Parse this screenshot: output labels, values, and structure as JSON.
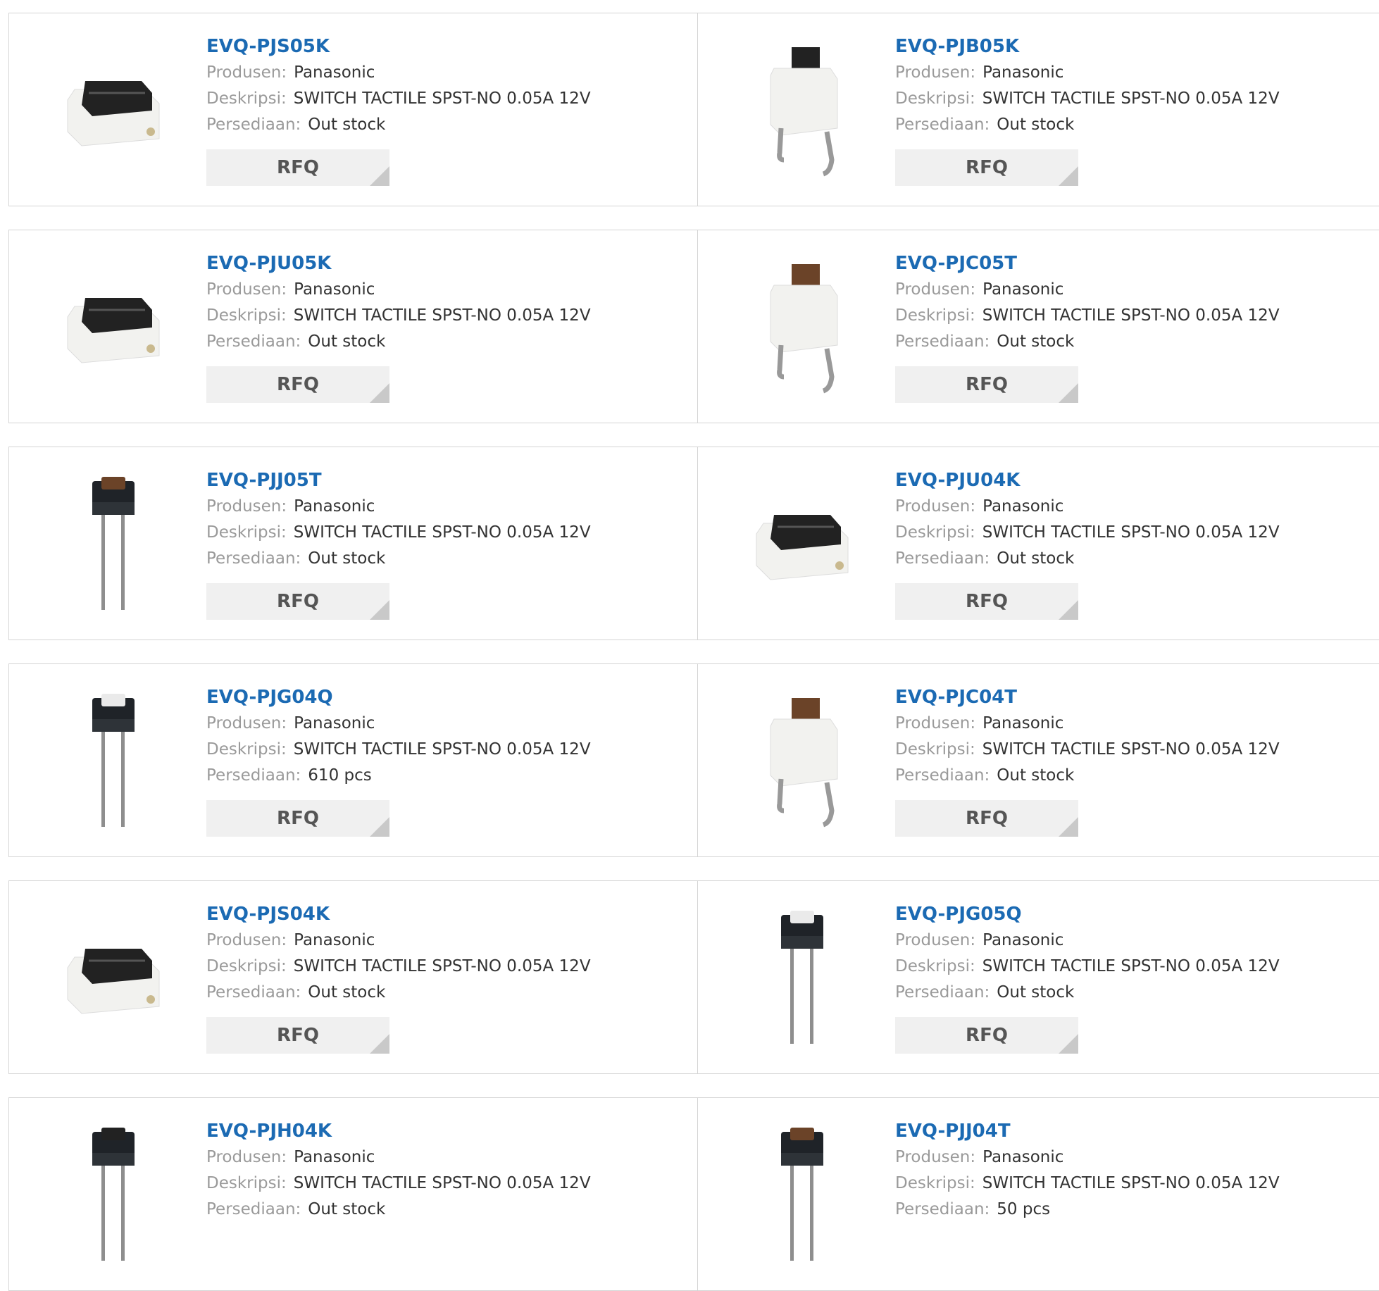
{
  "labels": {
    "manufacturer": "Produsen:",
    "description": "Deskripsi:",
    "stock": "Persediaan:",
    "rfq": "RFQ"
  },
  "colors": {
    "link": "#1b6ab3",
    "label": "#9a9a9a",
    "button_bg": "#f0f0f0"
  },
  "products": [
    {
      "pn": "EVQ-PJS05K",
      "manufacturer": "Panasonic",
      "description": "SWITCH TACTILE SPST-NO 0.05A 12V",
      "stock": "Out stock",
      "image": "switch-smd-black-icon",
      "show_rfq": true
    },
    {
      "pn": "EVQ-PJB05K",
      "manufacturer": "Panasonic",
      "description": "SWITCH TACTILE SPST-NO 0.05A 12V",
      "stock": "Out stock",
      "image": "switch-ra-black-icon",
      "show_rfq": true
    },
    {
      "pn": "EVQ-PJU05K",
      "manufacturer": "Panasonic",
      "description": "SWITCH TACTILE SPST-NO 0.05A 12V",
      "stock": "Out stock",
      "image": "switch-smd-black-icon",
      "show_rfq": true
    },
    {
      "pn": "EVQ-PJC05T",
      "manufacturer": "Panasonic",
      "description": "SWITCH TACTILE SPST-NO 0.05A 12V",
      "stock": "Out stock",
      "image": "switch-ra-brown-icon",
      "show_rfq": true
    },
    {
      "pn": "EVQ-PJJ05T",
      "manufacturer": "Panasonic",
      "description": "SWITCH TACTILE SPST-NO 0.05A 12V",
      "stock": "Out stock",
      "image": "switch-th-brown-icon",
      "show_rfq": true
    },
    {
      "pn": "EVQ-PJU04K",
      "manufacturer": "Panasonic",
      "description": "SWITCH TACTILE SPST-NO 0.05A 12V",
      "stock": "Out stock",
      "image": "switch-smd-black-icon",
      "show_rfq": true
    },
    {
      "pn": "EVQ-PJG04Q",
      "manufacturer": "Panasonic",
      "description": "SWITCH TACTILE SPST-NO 0.05A 12V",
      "stock": "610 pcs",
      "image": "switch-th-white-icon",
      "show_rfq": true
    },
    {
      "pn": "EVQ-PJC04T",
      "manufacturer": "Panasonic",
      "description": "SWITCH TACTILE SPST-NO 0.05A 12V",
      "stock": "Out stock",
      "image": "switch-ra-brown-icon",
      "show_rfq": true
    },
    {
      "pn": "EVQ-PJS04K",
      "manufacturer": "Panasonic",
      "description": "SWITCH TACTILE SPST-NO 0.05A 12V",
      "stock": "Out stock",
      "image": "switch-smd-black-icon",
      "show_rfq": true
    },
    {
      "pn": "EVQ-PJG05Q",
      "manufacturer": "Panasonic",
      "description": "SWITCH TACTILE SPST-NO 0.05A 12V",
      "stock": "Out stock",
      "image": "switch-th-white-icon",
      "show_rfq": true
    },
    {
      "pn": "EVQ-PJH04K",
      "manufacturer": "Panasonic",
      "description": "SWITCH TACTILE SPST-NO 0.05A 12V",
      "stock": "Out stock",
      "image": "switch-th-black-icon",
      "show_rfq": false
    },
    {
      "pn": "EVQ-PJJ04T",
      "manufacturer": "Panasonic",
      "description": "SWITCH TACTILE SPST-NO 0.05A 12V",
      "stock": "50 pcs",
      "image": "switch-th-brown-icon",
      "show_rfq": false
    }
  ]
}
